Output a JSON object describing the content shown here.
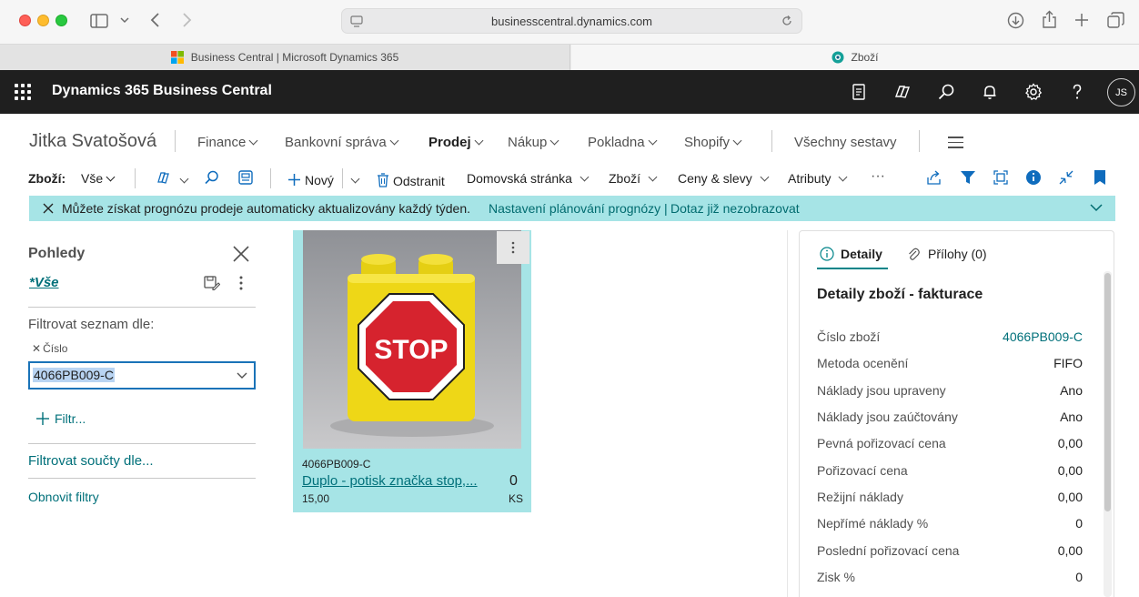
{
  "browser": {
    "url": "businesscentral.dynamics.com",
    "tabs": [
      {
        "label": "Business Central | Microsoft Dynamics 365"
      },
      {
        "label": "Zboží"
      }
    ]
  },
  "app": {
    "title": "Dynamics 365 Business Central",
    "user_initials": "JS"
  },
  "role_center": {
    "name": "Jitka Svatošová",
    "nav": [
      {
        "label": "Finance"
      },
      {
        "label": "Bankovní správa"
      },
      {
        "label": "Prodej"
      },
      {
        "label": "Nákup"
      },
      {
        "label": "Pokladna"
      },
      {
        "label": "Shopify"
      }
    ],
    "all_reports": "Všechny sestavy"
  },
  "action_bar": {
    "page_label": "Zboží:",
    "view_label": "Vše",
    "new_label": "Nový",
    "delete_label": "Odstranit",
    "home_label": "Domovská stránka",
    "item_label": "Zboží",
    "prices_label": "Ceny & slevy",
    "attributes_label": "Atributy",
    "more_label": "···"
  },
  "notification": {
    "text": "Můžete získat prognózu prodeje automaticky aktualizovány každý týden.",
    "link1": "Nastavení plánování prognózy |",
    "link2": "Dotaz již nezobrazovat"
  },
  "filter_pane": {
    "title": "Pohledy",
    "view_name": "*Vše",
    "filter_list_label": "Filtrovat seznam dle:",
    "field_label": "Číslo",
    "field_value": "4066PB009-C",
    "add_filter": "Filtr...",
    "totals_label": "Filtrovat součty dle...",
    "reset_label": "Obnovit filtry"
  },
  "item_card": {
    "image_text": "STOP",
    "code": "4066PB009-C",
    "name": "Duplo - potisk značka stop,...",
    "quantity": "0",
    "price": "15,00",
    "unit": "KS"
  },
  "factbox": {
    "tab_details": "Detaily",
    "tab_attachments": "Přílohy (0)",
    "title": "Detaily zboží - fakturace",
    "rows": [
      {
        "label": "Číslo zboží",
        "value": "4066PB009-C"
      },
      {
        "label": "Metoda ocenění",
        "value": "FIFO"
      },
      {
        "label": "Náklady jsou upraveny",
        "value": "Ano"
      },
      {
        "label": "Náklady jsou zaúčtovány",
        "value": "Ano"
      },
      {
        "label": "Pevná pořizovací cena",
        "value": "0,00"
      },
      {
        "label": "Pořizovací cena",
        "value": "0,00"
      },
      {
        "label": "Režijní náklady",
        "value": "0,00"
      },
      {
        "label": "Nepřímé náklady %",
        "value": "0"
      },
      {
        "label": "Poslední pořizovací cena",
        "value": "0,00"
      },
      {
        "label": "Zisk %",
        "value": "0"
      }
    ]
  },
  "colors": {
    "accent": "#008489",
    "link": "#00707a",
    "notification_bg": "#a6e4e6",
    "header_bg": "#1f1f1f"
  }
}
